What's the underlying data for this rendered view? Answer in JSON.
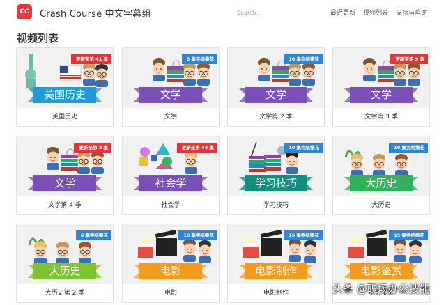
{
  "header": {
    "logo_text": "CC",
    "brand": "Crash Course 中文字幕组",
    "search_placeholder": "Search...",
    "nav": [
      "最近更新",
      "视频列表",
      "支持与鸣谢"
    ]
  },
  "page_title": "视频列表",
  "cards": [
    {
      "title": "美国历史",
      "ribbon": "美国历史",
      "ribbon_color": "#1e9ad6",
      "badge": "更新至第 41 集",
      "badge_color": "red",
      "art": "history-us"
    },
    {
      "title": "文学",
      "ribbon": "文学",
      "ribbon_color": "#7b4fb8",
      "badge": "8 集完结撒花",
      "badge_color": "blue",
      "art": "literature"
    },
    {
      "title": "文学第 2 季",
      "ribbon": "文学",
      "ribbon_color": "#7b4fb8",
      "badge": "16 集完结撒花",
      "badge_color": "blue",
      "art": "literature"
    },
    {
      "title": "文学第 3 季",
      "ribbon": "文学",
      "ribbon_color": "#7b4fb8",
      "badge": "更新至第 9 集",
      "badge_color": "red",
      "art": "literature"
    },
    {
      "title": "文学第 4 季",
      "ribbon": "文学",
      "ribbon_color": "#7b4fb8",
      "badge": "更新至第 2 集",
      "badge_color": "red",
      "art": "literature"
    },
    {
      "title": "社会学",
      "ribbon": "社会学",
      "ribbon_color": "#7b4fb8",
      "badge": "更新至第 44 集",
      "badge_color": "red",
      "art": "sociology"
    },
    {
      "title": "学习技巧",
      "ribbon": "学习技巧",
      "ribbon_color": "#0f8f7c",
      "badge": "10 集完结撒花",
      "badge_color": "blue",
      "art": "study"
    },
    {
      "title": "大历史",
      "ribbon": "大历史",
      "ribbon_color": "#33b05b",
      "badge": "10 集完结撒花",
      "badge_color": "blue",
      "art": "big-history"
    },
    {
      "title": "大历史第 2 季",
      "ribbon": "大历史",
      "ribbon_color": "#7fc32e",
      "badge": "6 集完结撒花",
      "badge_color": "blue",
      "art": "big-history"
    },
    {
      "title": "电影",
      "ribbon": "电影",
      "ribbon_color": "#f29b1e",
      "badge": "16 集完结撒花",
      "badge_color": "blue",
      "art": "film"
    },
    {
      "title": "电影制作",
      "ribbon": "电影制作",
      "ribbon_color": "#f29b1e",
      "badge": "15 集完结撒花",
      "badge_color": "blue",
      "art": "film"
    },
    {
      "title": "电影鉴赏",
      "ribbon": "电影鉴赏",
      "ribbon_color": "#f29b1e",
      "badge": "15 集完结撒花",
      "badge_color": "blue",
      "art": "film"
    }
  ],
  "watermark": "头条 @职场办公技能"
}
